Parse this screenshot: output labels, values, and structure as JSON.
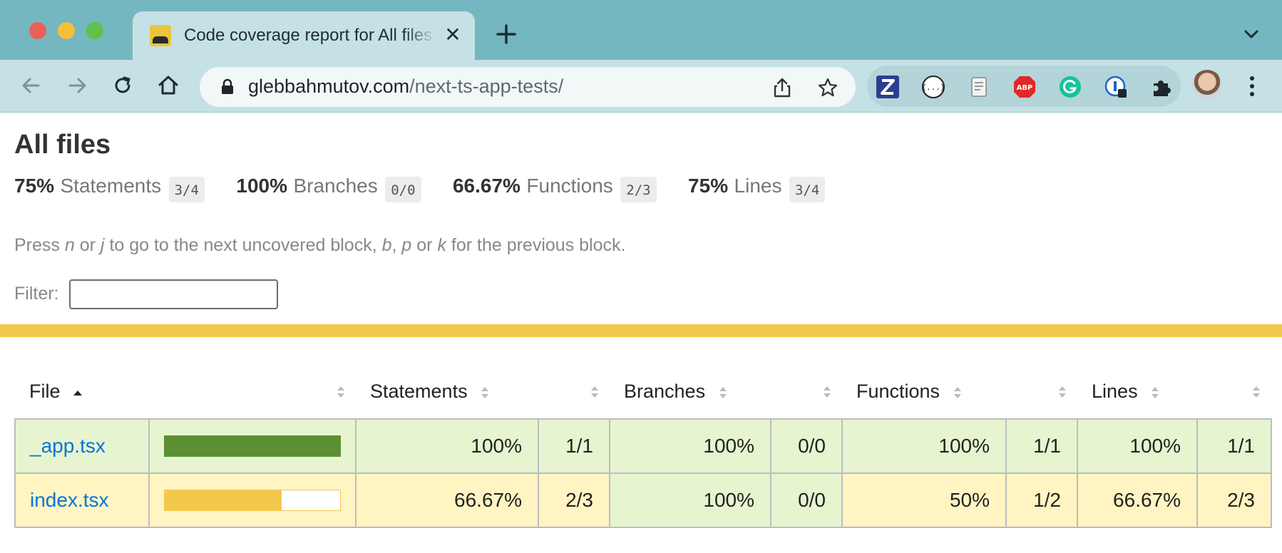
{
  "browser": {
    "tab_title": "Code coverage report for All files",
    "url_domain": "glebbahmutov.com",
    "url_path": "/next-ts-app-tests/"
  },
  "page": {
    "title": "All files",
    "summary": [
      {
        "pct": "75%",
        "label": "Statements",
        "frac": "3/4"
      },
      {
        "pct": "100%",
        "label": "Branches",
        "frac": "0/0"
      },
      {
        "pct": "66.67%",
        "label": "Functions",
        "frac": "2/3"
      },
      {
        "pct": "75%",
        "label": "Lines",
        "frac": "3/4"
      }
    ],
    "hint": {
      "press": "Press ",
      "n": "n",
      "or1": " or ",
      "j": "j",
      "mid": " to go to the next uncovered block, ",
      "b": "b",
      "comma": ", ",
      "p": "p",
      "or2": " or ",
      "k": "k",
      "end": " for the previous block."
    },
    "filter_label": "Filter:",
    "filter_value": ""
  },
  "table": {
    "headers": {
      "file": "File",
      "statements": "Statements",
      "branches": "Branches",
      "functions": "Functions",
      "lines": "Lines"
    },
    "rows": [
      {
        "file": "_app.tsx",
        "bar_fraction": 1.0,
        "statements": "100%",
        "statements_frac": "1/1",
        "branches": "100%",
        "branches_frac": "0/0",
        "functions": "100%",
        "functions_frac": "1/1",
        "lines": "100%",
        "lines_frac": "1/1"
      },
      {
        "file": "index.tsx",
        "bar_fraction": 0.6667,
        "statements": "66.67%",
        "statements_frac": "2/3",
        "branches": "100%",
        "branches_frac": "0/0",
        "functions": "50%",
        "functions_frac": "1/2",
        "lines": "66.67%",
        "lines_frac": "2/3"
      }
    ]
  },
  "colors": {
    "tabstrip": "#74b7c1",
    "high_bg": "#e6f5d0",
    "medium_bg": "#fff4c2",
    "high_bar": "#5b8f32",
    "medium_bar": "#f2c94c",
    "strip": "#f2c94c"
  },
  "icons": [
    "back-arrow-icon",
    "forward-arrow-icon",
    "reload-icon",
    "home-icon",
    "lock-icon",
    "share-icon",
    "star-icon",
    "extension-z-icon",
    "extension-json-icon",
    "extension-doc-icon",
    "adblock-icon",
    "grammarly-icon",
    "password-extension-icon",
    "puzzle-extensions-icon",
    "avatar",
    "kebab-menu-icon"
  ]
}
